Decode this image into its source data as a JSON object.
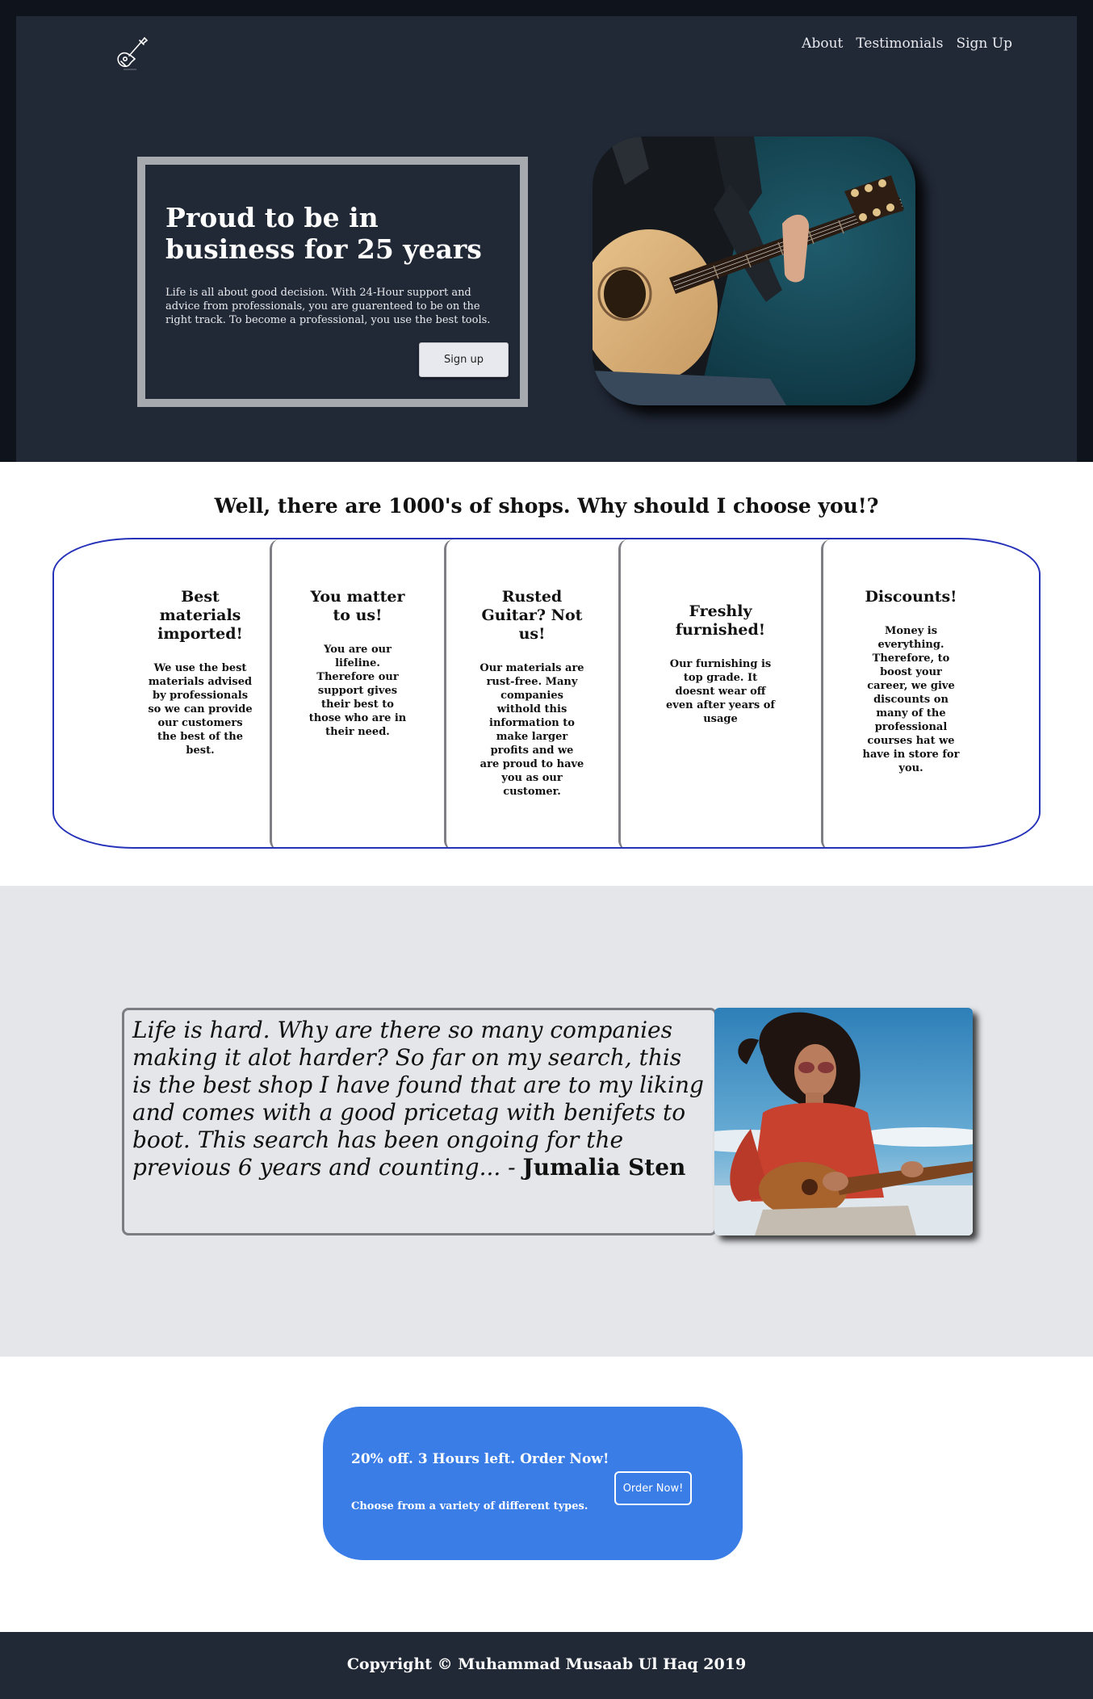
{
  "nav": {
    "logo_icon": "guitar-icon",
    "items": [
      "About",
      "Testimonials",
      "Sign Up"
    ]
  },
  "hero": {
    "title": "Proud to be in business for 25 years",
    "text": "Life is all about good decision. With 24-Hour support and advice from professionals, you are guarenteed to be on the right track. To become a professional, you use the best tools.",
    "button": "Sign up"
  },
  "why": {
    "title": "Well, there are 1000's of shops. Why should I choose you!?",
    "features": [
      {
        "title": "Best materials imported!",
        "text": "We use the best materials advised by professionals so we can provide our customers the best of the best."
      },
      {
        "title": "You matter to us!",
        "text": "You are our lifeline. Therefore our support gives their best to those who are in their need."
      },
      {
        "title": "Rusted Guitar? Not us!",
        "text": "Our materials are rust-free. Many companies withold this information to make larger profits and we are proud to have you as our customer."
      },
      {
        "title": "Freshly furnished!",
        "text": "Our furnishing is top grade. It doesnt wear off even after years of usage"
      },
      {
        "title": "Discounts!",
        "text": "Money is everything. Therefore, to boost your career, we give discounts on many of the professional courses hat we have in store for you."
      }
    ]
  },
  "testimonial": {
    "quote": "Life is hard. Why are there so many companies making it alot harder? So far on my search, this is the best shop I have found that are to my liking and comes with a good pricetag with benifets to boot. This search has been ongoing for the previous 6 years and counting... - ",
    "author": "Jumalia Sten"
  },
  "promo": {
    "title": "20% off. 3 Hours left. Order Now!",
    "subtitle": "Choose from a variety of different types.",
    "button": "Order Now!"
  },
  "footer": {
    "copyright": "Copyright © Muhammad Musaab Ul Haq 2019"
  },
  "colors": {
    "hero_bg": "#212836",
    "promo_bg": "#3a7de7",
    "features_border": "#2632b8",
    "testimonial_bg": "#e5e6ea"
  }
}
